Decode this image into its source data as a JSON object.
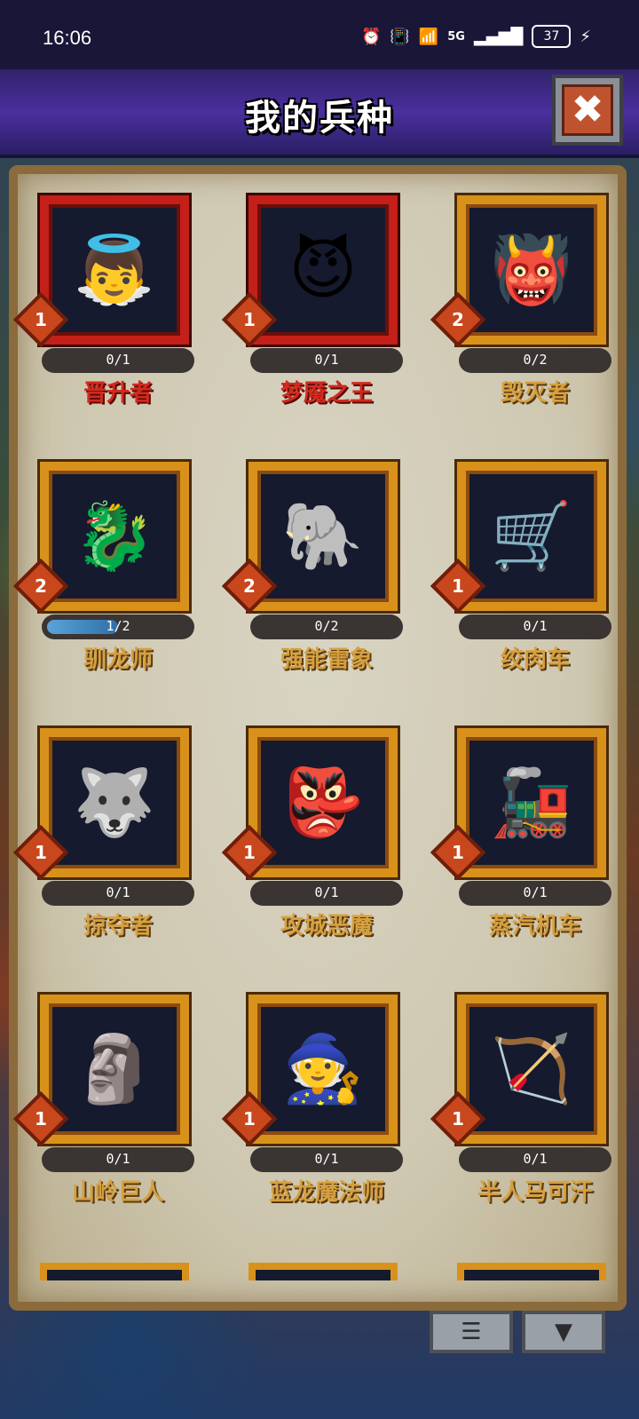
{
  "status_bar": {
    "time": "16:06",
    "network": "5G",
    "battery": "37"
  },
  "header": {
    "title": "我的兵种",
    "close_icon": "✖"
  },
  "units": [
    {
      "name": "晋升者",
      "progress": "0/1",
      "level": "1",
      "rarity": "red",
      "fill": 0
    },
    {
      "name": "梦魇之王",
      "progress": "0/1",
      "level": "1",
      "rarity": "red",
      "fill": 0
    },
    {
      "name": "毁灭者",
      "progress": "0/2",
      "level": "2",
      "rarity": "gold",
      "fill": 0
    },
    {
      "name": "驯龙师",
      "progress": "1/2",
      "level": "2",
      "rarity": "gold",
      "fill": 0.5
    },
    {
      "name": "强能雷象",
      "progress": "0/2",
      "level": "2",
      "rarity": "gold",
      "fill": 0
    },
    {
      "name": "绞肉车",
      "progress": "0/1",
      "level": "1",
      "rarity": "gold",
      "fill": 0
    },
    {
      "name": "掠夺者",
      "progress": "0/1",
      "level": "1",
      "rarity": "gold",
      "fill": 0
    },
    {
      "name": "攻城恶魔",
      "progress": "0/1",
      "level": "1",
      "rarity": "gold",
      "fill": 0
    },
    {
      "name": "蒸汽机车",
      "progress": "0/1",
      "level": "1",
      "rarity": "gold",
      "fill": 0
    },
    {
      "name": "山岭巨人",
      "progress": "0/1",
      "level": "1",
      "rarity": "gold",
      "fill": 0
    },
    {
      "name": "蓝龙魔法师",
      "progress": "0/1",
      "level": "1",
      "rarity": "gold",
      "fill": 0
    },
    {
      "name": "半人马可汗",
      "progress": "0/1",
      "level": "1",
      "rarity": "gold",
      "fill": 0
    }
  ],
  "icons": {
    "list_button": "list-icon",
    "filter_button": "filter-icon"
  }
}
